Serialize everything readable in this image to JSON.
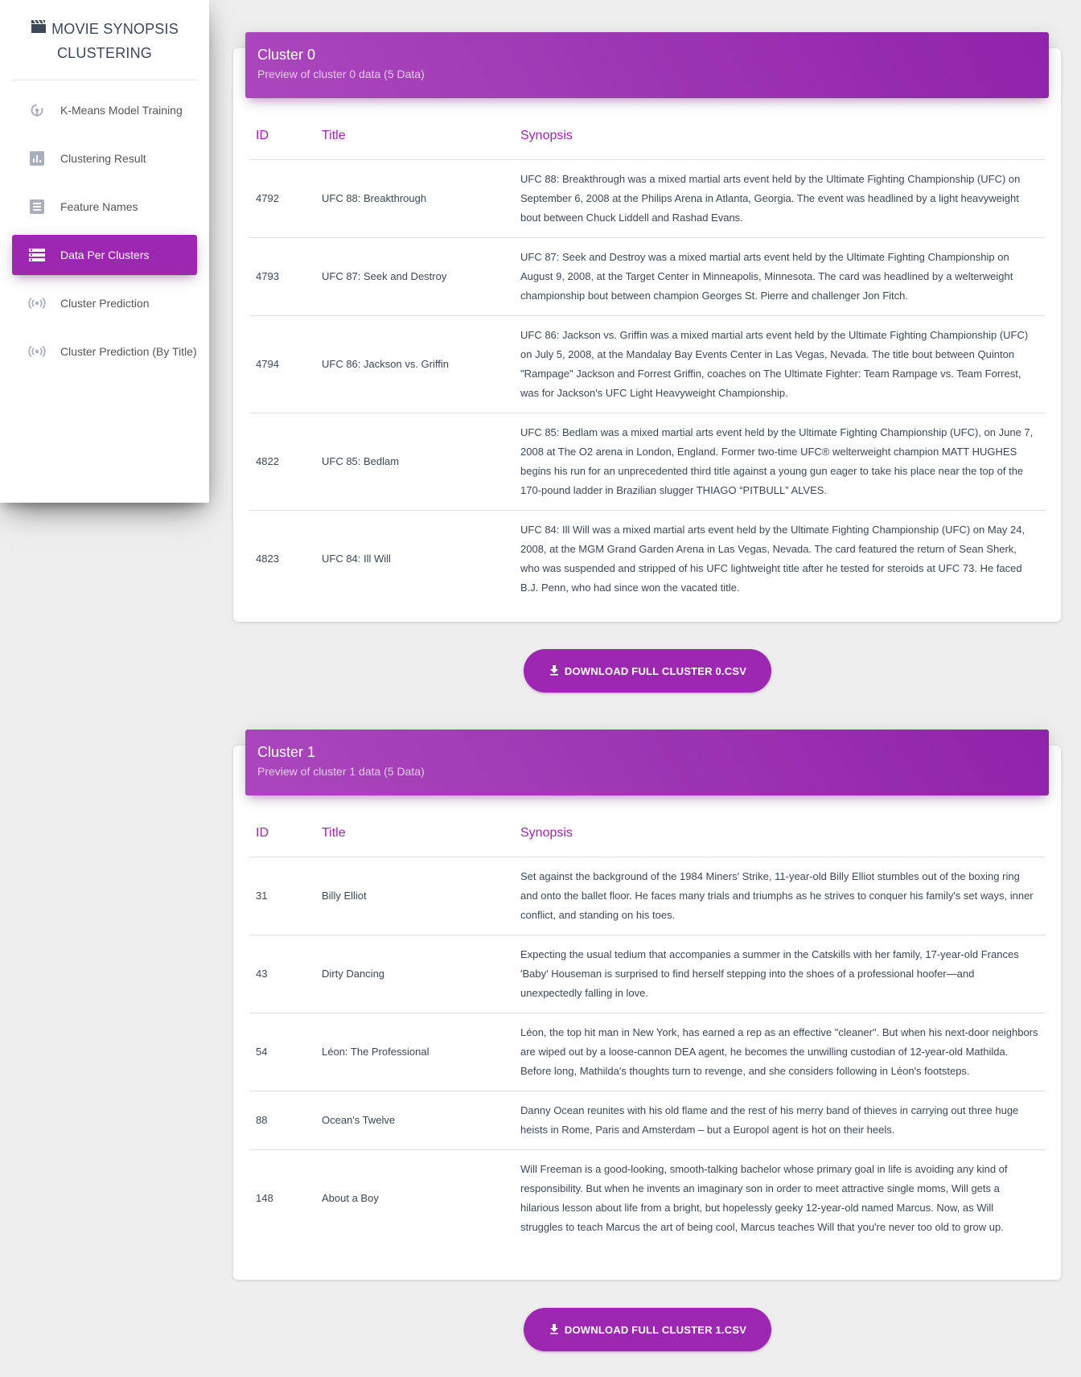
{
  "sidebar": {
    "brand_line1": "MOVIE SYNOPSIS",
    "brand_line2": "CLUSTERING",
    "brand_icon": "clapperboard-icon",
    "items": [
      {
        "label": "K-Means Model Training",
        "icon": "model-training-icon"
      },
      {
        "label": "Clustering Result",
        "icon": "bar-chart-icon"
      },
      {
        "label": "Feature Names",
        "icon": "list-icon"
      },
      {
        "label": "Data Per Clusters",
        "icon": "storage-icon",
        "active": true
      },
      {
        "label": "Cluster Prediction",
        "icon": "broadcast-icon"
      },
      {
        "label": "Cluster Prediction (By Title)",
        "icon": "broadcast-icon"
      }
    ]
  },
  "colors": {
    "accent": "#9c27b0",
    "background": "#eeeeee"
  },
  "clusters": [
    {
      "title": "Cluster 0",
      "subtitle": "Preview of cluster 0 data (5 Data)",
      "columns": [
        "ID",
        "Title",
        "Synopsis"
      ],
      "rows": [
        {
          "id": "4792",
          "title": "UFC 88: Breakthrough",
          "synopsis": "UFC 88: Breakthrough was a mixed martial arts event held by the Ultimate Fighting Championship (UFC) on September 6, 2008 at the Philips Arena in Atlanta, Georgia. The event was headlined by a light heavyweight bout between Chuck Liddell and Rashad Evans."
        },
        {
          "id": "4793",
          "title": "UFC 87: Seek and Destroy",
          "synopsis": "UFC 87: Seek and Destroy was a mixed martial arts event held by the Ultimate Fighting Championship on August 9, 2008, at the Target Center in Minneapolis, Minnesota. The card was headlined by a welterweight championship bout between champion Georges St. Pierre and challenger Jon Fitch."
        },
        {
          "id": "4794",
          "title": "UFC 86: Jackson vs. Griffin",
          "synopsis": "UFC 86: Jackson vs. Griffin was a mixed martial arts event held by the Ultimate Fighting Championship (UFC) on July 5, 2008, at the Mandalay Bay Events Center in Las Vegas, Nevada. The title bout between Quinton \"Rampage\" Jackson and Forrest Griffin, coaches on The Ultimate Fighter: Team Rampage vs. Team Forrest, was for Jackson's UFC Light Heavyweight Championship."
        },
        {
          "id": "4822",
          "title": "UFC 85: Bedlam",
          "synopsis": "UFC 85: Bedlam was a mixed martial arts event held by the Ultimate Fighting Championship (UFC), on June 7, 2008 at The O2 arena in London, England. Former two-time UFC® welterweight champion MATT HUGHES begins his run for an unprecedented third title against a young gun eager to take his place near the top of the 170-pound ladder in Brazilian slugger THIAGO “PITBULL” ALVES."
        },
        {
          "id": "4823",
          "title": "UFC 84: Ill Will",
          "synopsis": "UFC 84: Ill Will was a mixed martial arts event held by the Ultimate Fighting Championship (UFC) on May 24, 2008, at the MGM Grand Garden Arena in Las Vegas, Nevada. The card featured the return of Sean Sherk, who was suspended and stripped of his UFC lightweight title after he tested for steroids at UFC 73. He faced B.J. Penn, who had since won the vacated title."
        }
      ],
      "download_label": "DOWNLOAD FULL CLUSTER 0.CSV"
    },
    {
      "title": "Cluster 1",
      "subtitle": "Preview of cluster 1 data (5 Data)",
      "columns": [
        "ID",
        "Title",
        "Synopsis"
      ],
      "rows": [
        {
          "id": "31",
          "title": "Billy Elliot",
          "synopsis": "Set against the background of the 1984 Miners' Strike, 11-year-old Billy Elliot stumbles out of the boxing ring and onto the ballet floor. He faces many trials and triumphs as he strives to conquer his family's set ways, inner conflict, and standing on his toes."
        },
        {
          "id": "43",
          "title": "Dirty Dancing",
          "synopsis": "Expecting the usual tedium that accompanies a summer in the Catskills with her family, 17-year-old Frances 'Baby' Houseman is surprised to find herself stepping into the shoes of a professional hoofer—and unexpectedly falling in love."
        },
        {
          "id": "54",
          "title": "Léon: The Professional",
          "synopsis": "Léon, the top hit man in New York, has earned a rep as an effective \"cleaner\". But when his next-door neighbors are wiped out by a loose-cannon DEA agent, he becomes the unwilling custodian of 12-year-old Mathilda. Before long, Mathilda's thoughts turn to revenge, and she considers following in Léon's footsteps."
        },
        {
          "id": "88",
          "title": "Ocean's Twelve",
          "synopsis": "Danny Ocean reunites with his old flame and the rest of his merry band of thieves in carrying out three huge heists in Rome, Paris and Amsterdam – but a Europol agent is hot on their heels."
        },
        {
          "id": "148",
          "title": "About a Boy",
          "synopsis": "Will Freeman is a good-looking, smooth-talking bachelor whose primary goal in life is avoiding any kind of responsibility. But when he invents an imaginary son in order to meet attractive single moms, Will gets a hilarious lesson about life from a bright, but hopelessly geeky 12-year-old named Marcus. Now, as Will struggles to teach Marcus the art of being cool, Marcus teaches Will that you're never too old to grow up."
        }
      ],
      "download_label": "DOWNLOAD FULL CLUSTER 1.CSV"
    }
  ]
}
